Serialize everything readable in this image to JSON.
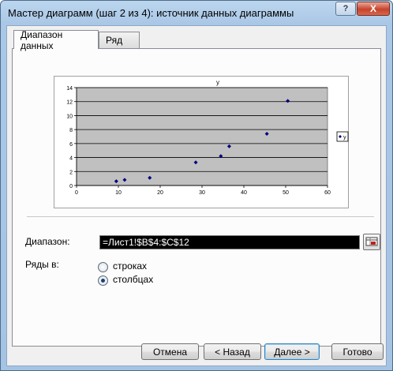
{
  "window": {
    "title": "Мастер диаграмм (шаг 2 из 4): источник данных диаграммы",
    "help_label": "?",
    "close_label": "X"
  },
  "tabs": [
    {
      "label": "Диапазон данных",
      "active": true
    },
    {
      "label": "Ряд",
      "active": false
    }
  ],
  "chart_data": {
    "type": "scatter",
    "title": "y",
    "xlim": [
      0,
      60
    ],
    "ylim": [
      0,
      14
    ],
    "x_ticks": [
      0,
      10,
      20,
      30,
      40,
      50,
      60
    ],
    "y_ticks": [
      0,
      2,
      4,
      6,
      8,
      10,
      12,
      14
    ],
    "grid": true,
    "plot_background": "#c0c0c0",
    "marker_color": "#000080",
    "legend": {
      "entries": [
        "y"
      ],
      "position": "right"
    },
    "series": [
      {
        "name": "y",
        "points": [
          [
            9.5,
            0.6
          ],
          [
            11.5,
            0.8
          ],
          [
            17.5,
            1.1
          ],
          [
            28.5,
            3.3
          ],
          [
            34.5,
            4.2
          ],
          [
            36.5,
            5.6
          ],
          [
            45.5,
            7.4
          ],
          [
            50.5,
            12.1
          ]
        ]
      }
    ]
  },
  "form": {
    "range_label": "Диапазон:",
    "range_value": "=Лист1!$B$4:$C$12",
    "series_in_label": "Ряды в:",
    "options": [
      {
        "label": "строках",
        "checked": false
      },
      {
        "label": "столбцах",
        "checked": true
      }
    ]
  },
  "buttons": {
    "cancel": "Отмена",
    "back": "< Назад",
    "next": "Далее >",
    "finish": "Готово"
  }
}
